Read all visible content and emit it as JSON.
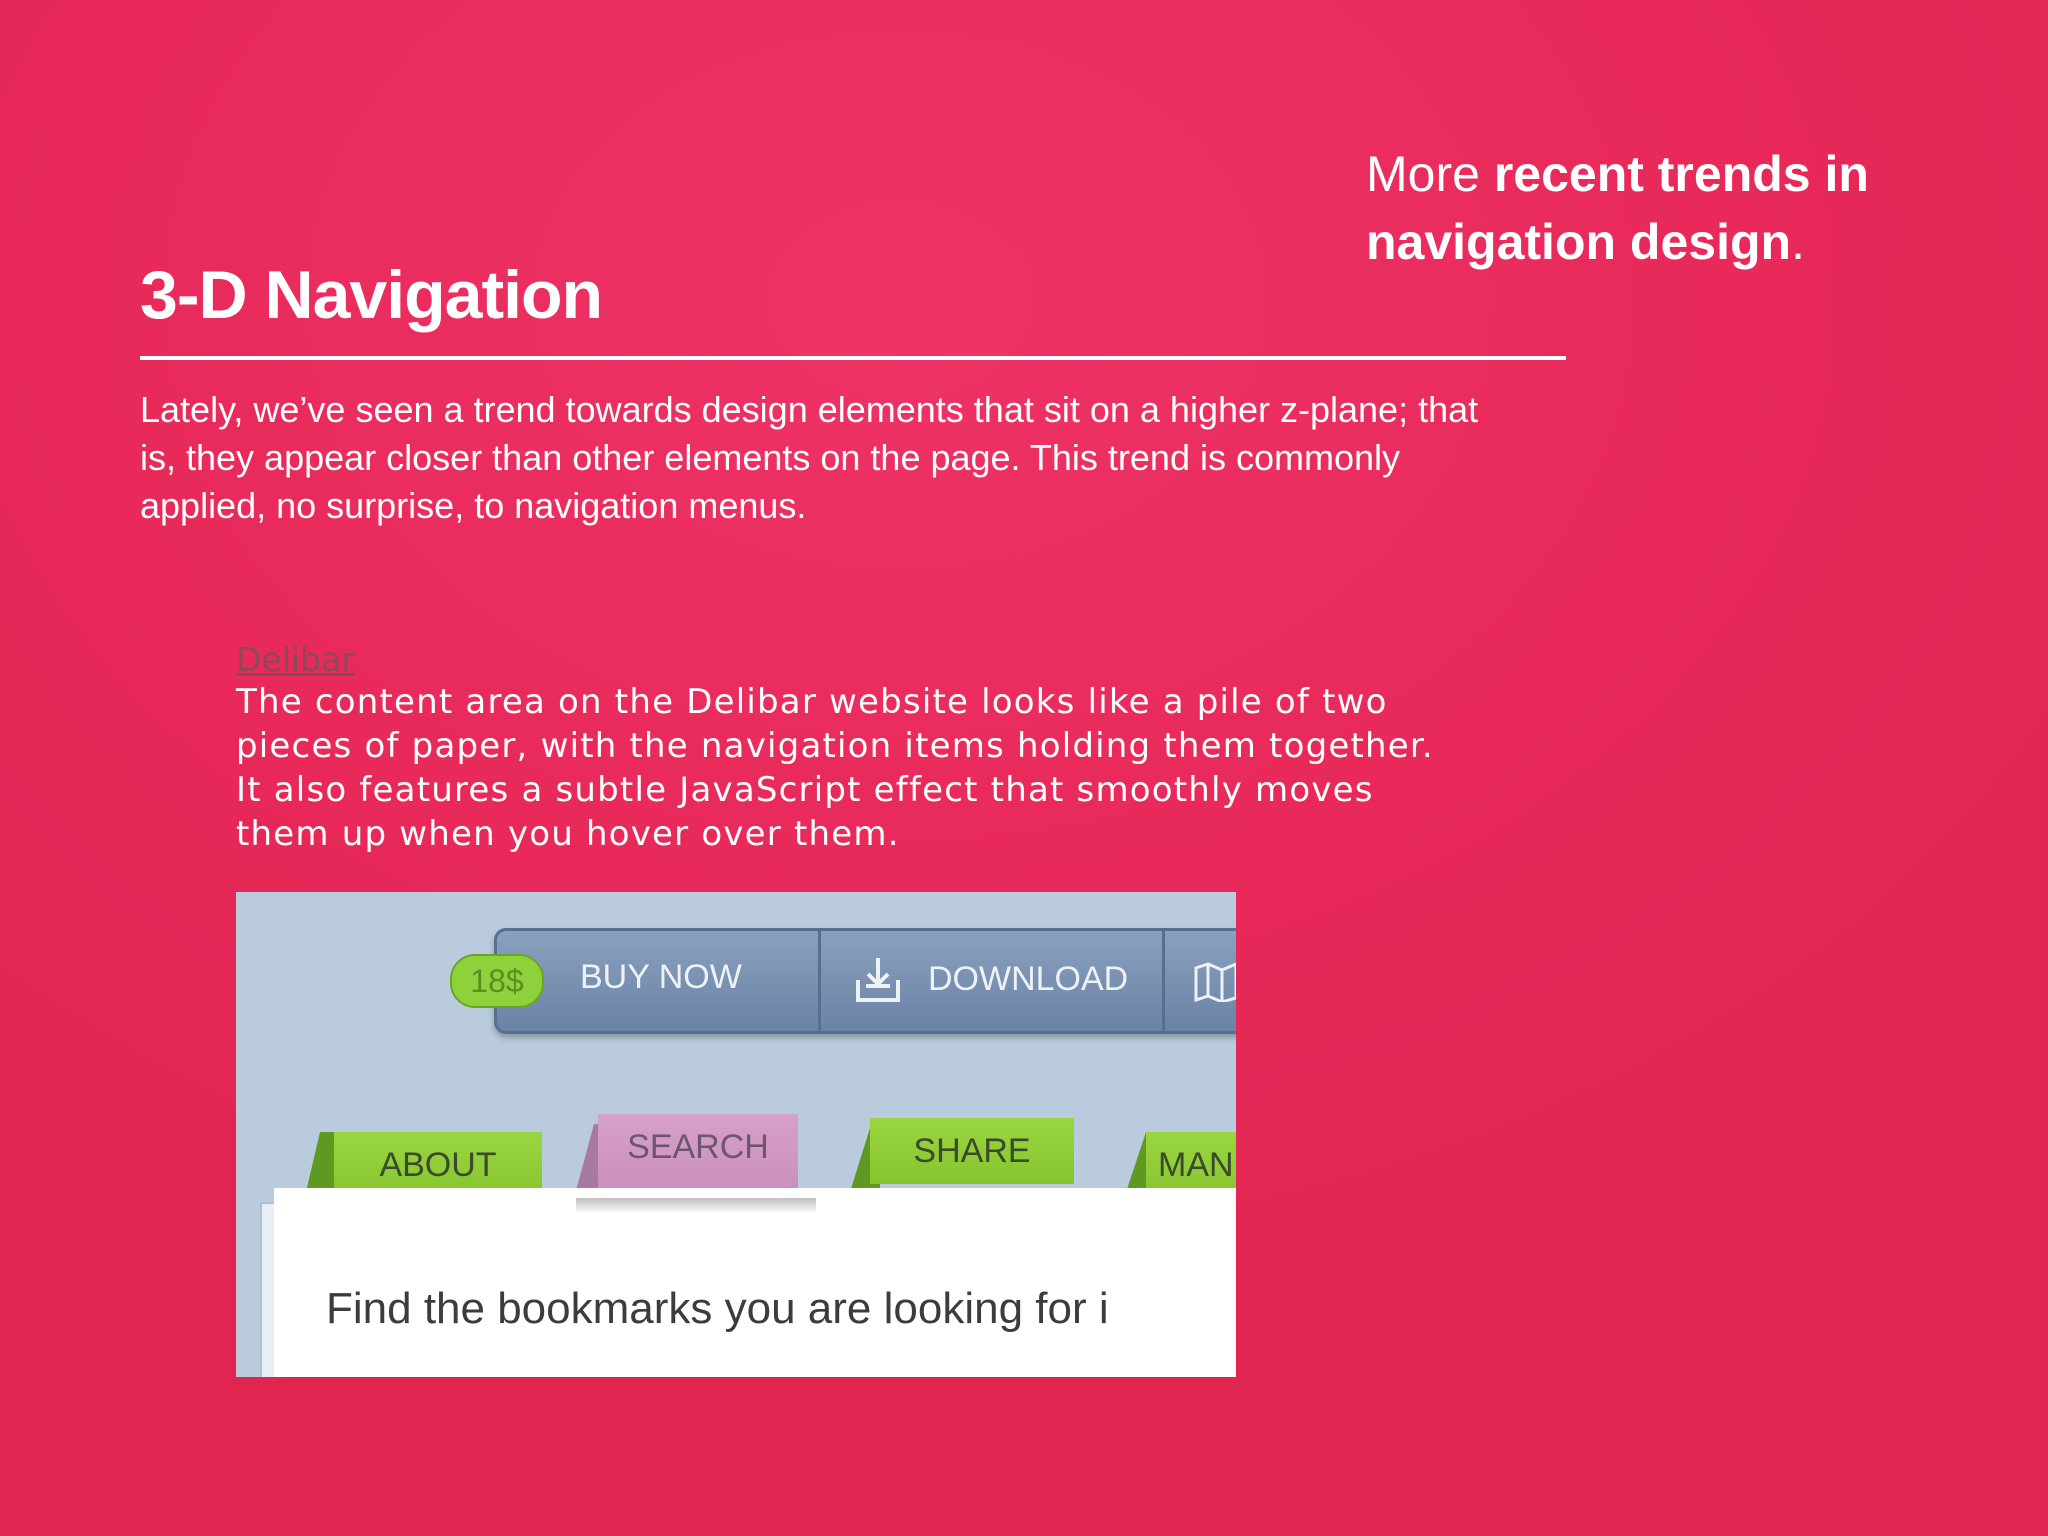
{
  "tagline": {
    "prefix": "More ",
    "emphasis": "recent trends in navigation design",
    "suffix": "."
  },
  "title": "3-D Navigation",
  "intro": "Lately, we’ve seen a trend towards design elements that sit on a higher z-plane; that is, they appear closer than other elements on the page. This trend is commonly applied, no surprise, to navigation menus.",
  "example": {
    "link_text": "Delibar",
    "description": "The content area on the Delibar website looks like a pile of two pieces of paper, with the navigation items holding them together. It also features a subtle JavaScript effect that smoothly moves them up when you hover over them."
  },
  "screenshot": {
    "price": "18$",
    "buy_now": "BUY NOW",
    "download": "DOWNLOAD",
    "tabs": [
      "ABOUT",
      "SEARCH",
      "SHARE",
      "MAN"
    ],
    "content_text": "Find the bookmarks you are looking for i",
    "colors": {
      "tab_green": "#8fd13a",
      "tab_pink": "#d39fc7",
      "bar": "#7189ad"
    },
    "icons": [
      "download-icon",
      "map-icon"
    ]
  }
}
